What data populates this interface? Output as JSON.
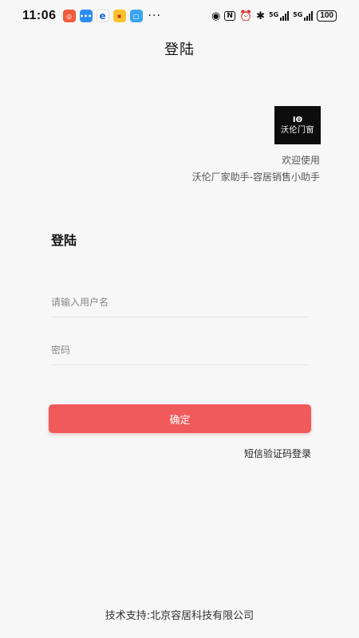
{
  "status_bar": {
    "time": "11:06",
    "app_icons": [
      "app-icon-1",
      "app-icon-2",
      "app-icon-3",
      "app-icon-4",
      "app-icon-5"
    ],
    "more": "···",
    "network_1": "5G",
    "network_2": "5G",
    "battery": "100"
  },
  "header": {
    "title": "登陆"
  },
  "brand": {
    "logo_mark": "IΘ",
    "logo_text": "沃伦门窗",
    "welcome": "欢迎使用",
    "subtitle": "沃伦厂家助手-容居销售小助手"
  },
  "form": {
    "heading": "登陆",
    "username": {
      "value": "",
      "placeholder": "请输入用户名"
    },
    "password": {
      "value": "",
      "placeholder": "密码"
    },
    "submit_label": "确定",
    "sms_login_label": "短信验证码登录"
  },
  "footer": {
    "support": "技术支持:北京容居科技有限公司"
  },
  "colors": {
    "accent": "#f05a5a",
    "background": "#f7f7f7",
    "logo_bg": "#0d0d0d"
  }
}
